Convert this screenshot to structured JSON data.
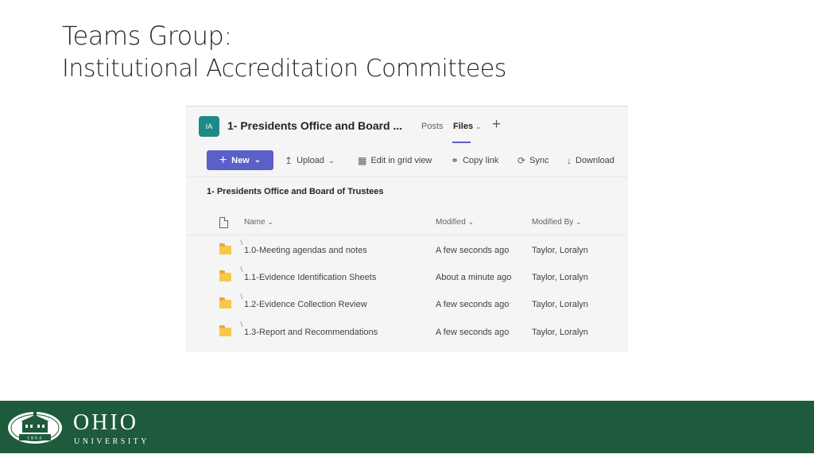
{
  "slide": {
    "title_line1": "Teams Group:",
    "title_line2": "Institutional Accreditation Committees"
  },
  "teams": {
    "team_avatar": "IA",
    "team_name": "1- Presidents Office and Board ...",
    "tabs": [
      {
        "label": "Posts",
        "active": false
      },
      {
        "label": "Files",
        "active": true
      }
    ],
    "add_tab_icon": "plus-icon",
    "accent_color": "#5b5fc7",
    "toolbar": {
      "new_label": "New",
      "upload_label": "Upload",
      "grid_label": "Edit in grid view",
      "copy_label": "Copy link",
      "sync_label": "Sync",
      "download_label": "Download"
    },
    "breadcrumb": "1- Presidents Office and Board of Trustees",
    "columns": {
      "name": "Name",
      "modified": "Modified",
      "modified_by": "Modified By"
    },
    "rows": [
      {
        "name": "1.0-Meeting agendas and notes",
        "modified": "A few seconds ago",
        "modified_by": "Taylor, Loralyn"
      },
      {
        "name": "1.1-Evidence Identification Sheets",
        "modified": "About a minute ago",
        "modified_by": "Taylor, Loralyn"
      },
      {
        "name": "1.2-Evidence Collection Review",
        "modified": "A few seconds ago",
        "modified_by": "Taylor, Loralyn"
      },
      {
        "name": "1.3-Report and Recommendations",
        "modified": "A few seconds ago",
        "modified_by": "Taylor, Loralyn"
      }
    ]
  },
  "footer": {
    "brand_color": "#1e5a3c",
    "university_name": "OHIO",
    "university_sub": "UNIVERSITY",
    "seal_year": "1804"
  }
}
